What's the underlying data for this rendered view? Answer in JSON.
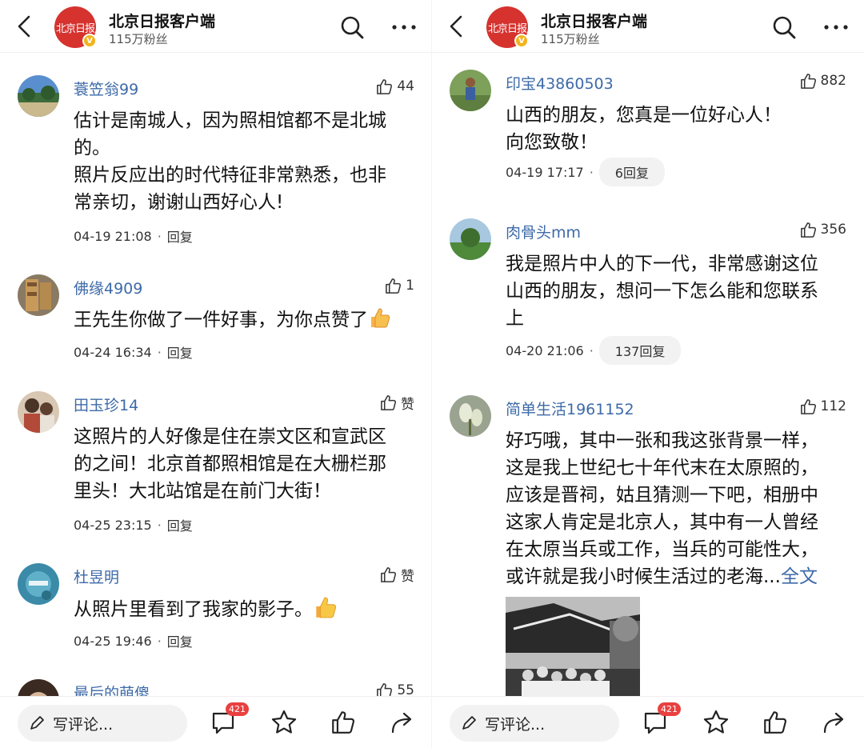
{
  "header": {
    "account_name": "北京日报客户端",
    "fans": "115万粉丝",
    "logo_text": "北京日报",
    "verified_mark": "V"
  },
  "left": {
    "comments": [
      {
        "user": "蓑笠翁99",
        "likes": "44",
        "text": "估计是南城人，因为照相馆都不是北城\n的。\n照片反应出的时代特征非常熟悉，也非\n常亲切，谢谢山西好心人!",
        "time": "04-19 21:08",
        "reply": "回复"
      },
      {
        "user": "佛缘4909",
        "likes": "1",
        "text": "王先生你做了一件好事，为你点赞了",
        "time": "04-24 16:34",
        "reply": "回复"
      },
      {
        "user": "田玉珍14",
        "likes": "赞",
        "text": "这照片的人好像是住在崇文区和宣武区\n的之间！北京首都照相馆是在大栅栏那\n里头！大北站馆是在前门大街！",
        "time": "04-25 23:15",
        "reply": "回复"
      },
      {
        "user": "杜昱明",
        "likes": "赞",
        "text": "从照片里看到了我家的影子。",
        "time": "04-25 19:46",
        "reply": "回复"
      },
      {
        "user": "最后的萌傻",
        "likes": "55"
      }
    ]
  },
  "right": {
    "comments": [
      {
        "user": "印宝43860503",
        "likes": "882",
        "text": "山西的朋友，您真是一位好心人！\n向您致敬！",
        "time": "04-19 17:17",
        "reply": "6回复"
      },
      {
        "user": "肉骨头mm",
        "likes": "356",
        "text": "我是照片中人的下一代，非常感谢这位\n山西的朋友，想问一下怎么能和您联系\n上",
        "time": "04-20 21:06",
        "reply": "137回复"
      },
      {
        "user": "简单生活1961152",
        "likes": "112",
        "text": "好巧哦，其中一张和我这张背景一样，\n这是我上世纪七十年代末在太原照的，\n应该是晋祠，姑且猜测一下吧，相册中\n这家人肯定是北京人，其中有一人曾经\n在太原当兵或工作，当兵的可能性大，\n或许就是我小时候生活过的老海...",
        "more": "全文"
      }
    ]
  },
  "bottom": {
    "comment_placeholder": "写评论...",
    "comment_count": "421"
  },
  "colors": {
    "username": "#3d6aa8",
    "brand_red": "#d6322e",
    "badge_red": "#e94040",
    "verified": "#f3b31b"
  },
  "icons": [
    "back-icon",
    "search-icon",
    "more-icon",
    "thumb-up-icon",
    "thumbs-up-emoji-icon",
    "pen-icon",
    "comment-icon",
    "star-icon",
    "share-icon"
  ]
}
